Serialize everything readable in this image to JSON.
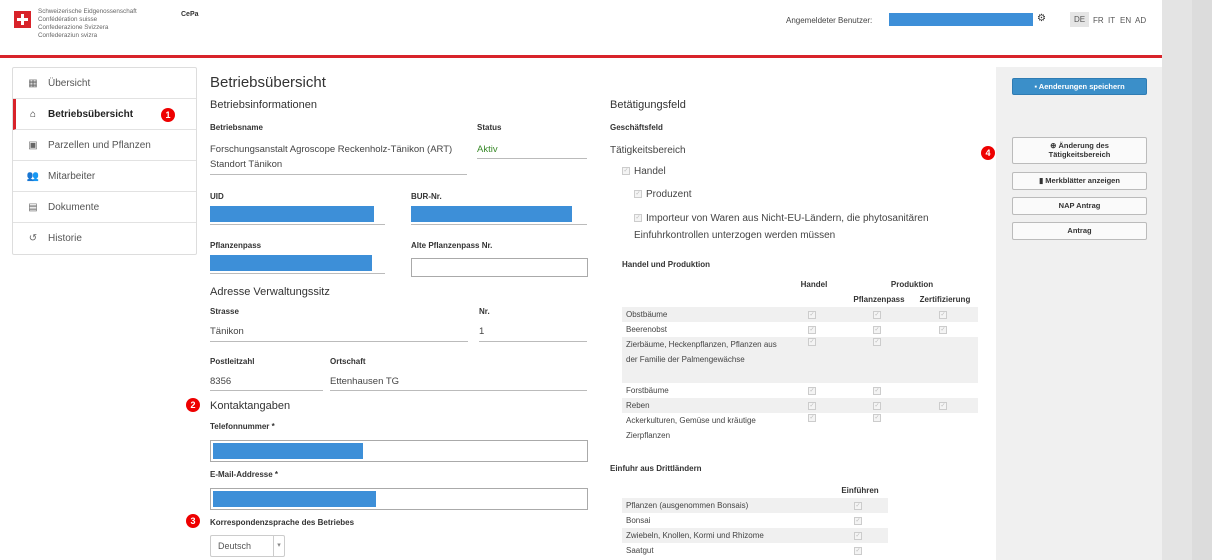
{
  "header": {
    "confederation": [
      "Schweizerische Eidgenossenschaft",
      "Confédération suisse",
      "Confederazione Svizzera",
      "Confederaziun svizra"
    ],
    "app_name": "CePa",
    "user_label": "Angemeldeter Benutzer:",
    "languages": [
      "DE",
      "FR",
      "IT",
      "EN",
      "AD"
    ],
    "active_language": "DE"
  },
  "sidebar": {
    "items": [
      {
        "label": "Übersicht",
        "icon": "calendar-icon"
      },
      {
        "label": "Betriebsübersicht",
        "icon": "home-icon",
        "active": true
      },
      {
        "label": "Parzellen und Pflanzen",
        "icon": "image-icon"
      },
      {
        "label": "Mitarbeiter",
        "icon": "users-icon"
      },
      {
        "label": "Dokumente",
        "icon": "documents-icon"
      },
      {
        "label": "Historie",
        "icon": "history-icon"
      }
    ]
  },
  "annotations": [
    "1",
    "2",
    "3",
    "4"
  ],
  "main": {
    "title": "Betriebsübersicht",
    "info_heading": "Betriebsinformationen",
    "name_label": "Betriebsname",
    "name_value": "Forschungsanstalt Agroscope Reckenholz-Tänikon (ART) Standort Tänikon",
    "status_label": "Status",
    "status_value": "Aktiv",
    "uid_label": "UID",
    "bur_label": "BUR-Nr.",
    "plant_pass_label": "Pflanzenpass",
    "old_plant_pass_label": "Alte Pflanzenpass Nr.",
    "address_heading": "Adresse Verwaltungssitz",
    "street_label": "Strasse",
    "street_value": "Tänikon",
    "nr_label": "Nr.",
    "nr_value": "1",
    "zip_label": "Postleitzahl",
    "zip_value": "8356",
    "city_label": "Ortschaft",
    "city_value": "Ettenhausen TG",
    "contact_heading": "Kontaktangaben",
    "phone_label": "Telefonnummer *",
    "email_label": "E-Mail-Addresse *",
    "language_label": "Korrespondenzsprache des Betriebes",
    "language_value": "Deutsch"
  },
  "activity": {
    "heading": "Betätigungsfeld",
    "business_field": "Geschäftsfeld",
    "activity_area": "Tätigkeitsbereich",
    "trade": "Handel",
    "producer": "Produzent",
    "importer": "Importeur von Waren aus Nicht-EU-Ländern, die phytosanitären Einfuhrkontrollen unterzogen werden müssen"
  },
  "trade_table": {
    "heading": "Handel und Produktion",
    "col_trade": "Handel",
    "col_production": "Produktion",
    "col_plant_pass": "Pflanzenpass",
    "col_certification": "Zertifizierung",
    "rows": [
      {
        "label": "Obstbäume",
        "cells": [
          true,
          true,
          true
        ]
      },
      {
        "label": "Beerenobst",
        "cells": [
          true,
          true,
          true
        ]
      },
      {
        "label": "Zierbäume, Heckenpflanzen, Pflanzen aus der Familie der Palmengewächse",
        "cells": [
          true,
          true,
          false
        ]
      },
      {
        "label": "Forstbäume",
        "cells": [
          true,
          true,
          false
        ]
      },
      {
        "label": "Reben",
        "cells": [
          true,
          true,
          true
        ]
      },
      {
        "label": "Ackerkulturen, Gemüse und kräutige Zierpflanzen",
        "cells": [
          true,
          true,
          false
        ]
      }
    ]
  },
  "import_table": {
    "heading": "Einfuhr aus Drittländern",
    "col_import": "Einführen",
    "rows": [
      "Pflanzen (ausgenommen Bonsais)",
      "Bonsai",
      "Zwiebeln, Knollen, Kormi und Rhizome",
      "Saatgut"
    ]
  },
  "actions": {
    "save": "Aenderungen speichern",
    "change_area": "Änderung des Tätigkeitsbereich",
    "leaflets": "Merkblätter anzeigen",
    "nap": "NAP Antrag",
    "request": "Antrag"
  }
}
